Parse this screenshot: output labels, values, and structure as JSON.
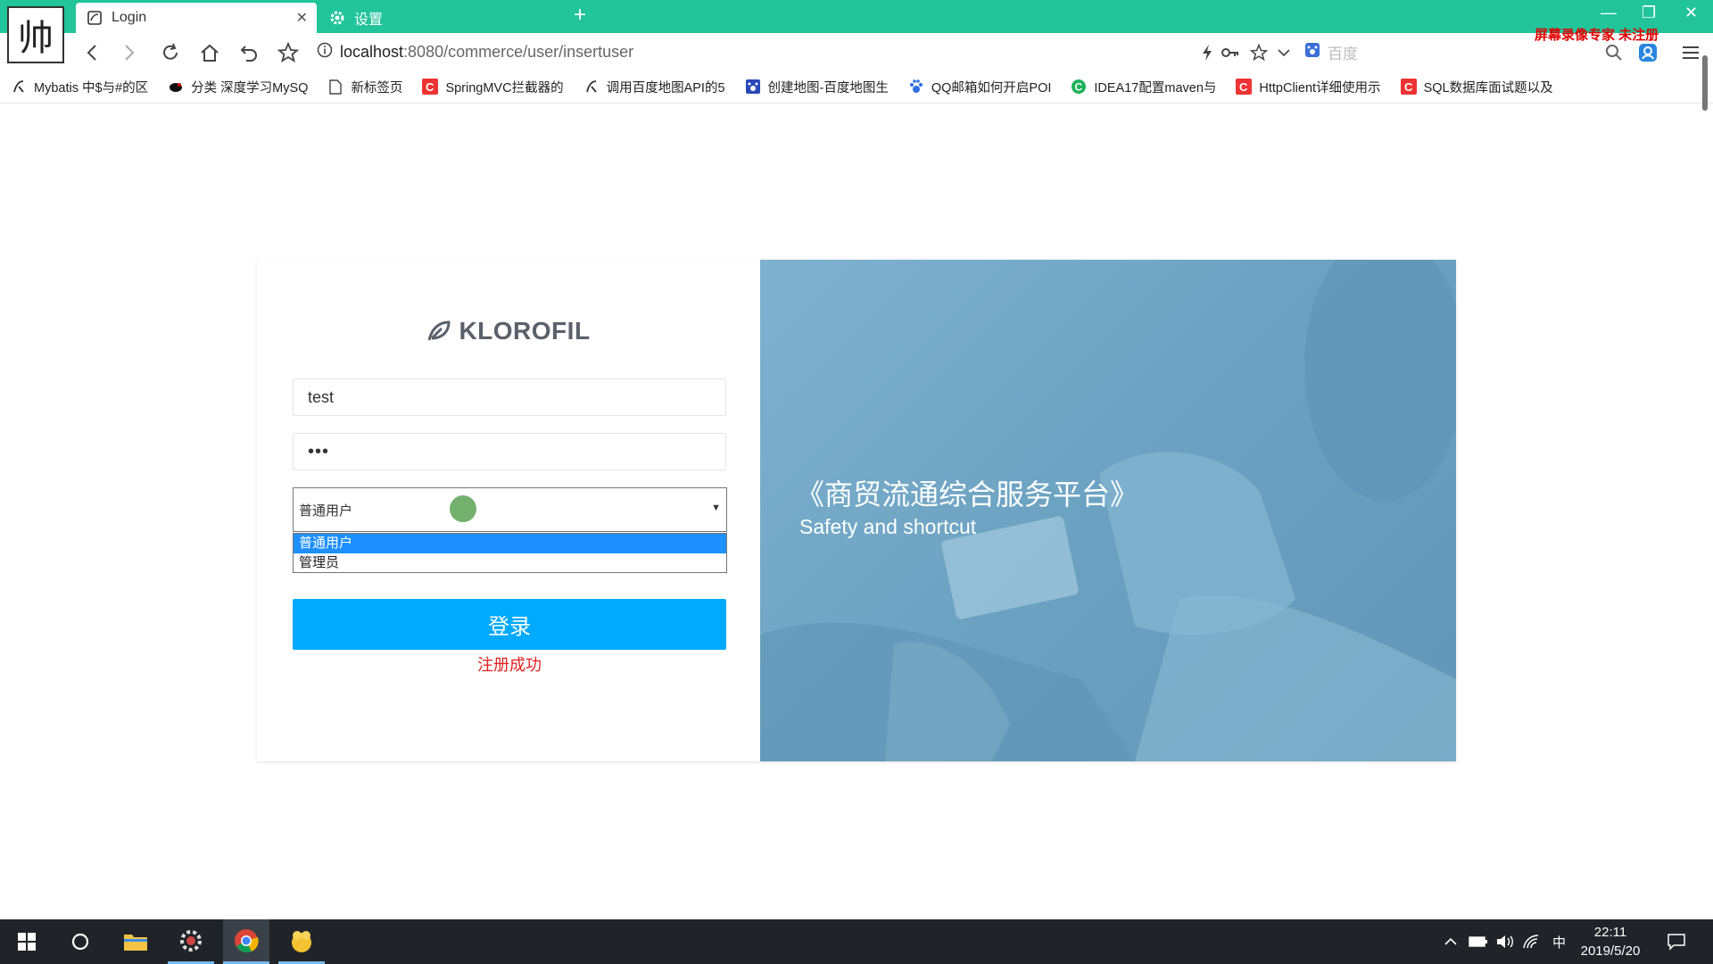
{
  "browser": {
    "tabs": [
      {
        "label": "Login",
        "active": true
      },
      {
        "label": "设置",
        "active": false
      }
    ],
    "address_host": "localhost",
    "address_path": ":8080/commerce/user/insertuser",
    "search_placeholder": "百度",
    "watermark": "屏幕录像专家 未注册",
    "bookmarks": [
      {
        "label": "Mybatis 中$与#的区",
        "icon": "bookmark-icon"
      },
      {
        "label": "分类 深度学习MySQ",
        "icon": "bird-icon"
      },
      {
        "label": "新标签页",
        "icon": "page-icon"
      },
      {
        "label": "SpringMVC拦截器的",
        "icon": "csdn-icon"
      },
      {
        "label": "调用百度地图API的5",
        "icon": "bookmark-icon"
      },
      {
        "label": "创建地图-百度地图生",
        "icon": "baidu-icon"
      },
      {
        "label": "QQ邮箱如何开启POI",
        "icon": "paw-icon"
      },
      {
        "label": "IDEA17配置maven与",
        "icon": "green-c-icon"
      },
      {
        "label": "HttpClient详细使用示",
        "icon": "csdn-icon"
      },
      {
        "label": "SQL数据库面试题以及",
        "icon": "csdn-icon"
      }
    ]
  },
  "login": {
    "brand": "KLOROFIL",
    "username_value": "test",
    "password_value": "•••",
    "role_selected": "普通用户",
    "role_options": [
      "普通用户",
      "管理员"
    ],
    "submit_label": "登录",
    "status_message": "注册成功"
  },
  "banner": {
    "title": "《商贸流通综合服务平台》",
    "subtitle": "Safety and shortcut"
  },
  "taskbar": {
    "time": "22:11",
    "date": "2019/5/20",
    "ime": "中"
  },
  "colors": {
    "titlebar": "#22c49a",
    "primary_button": "#00aaff",
    "status_text": "#e02020",
    "banner_bg": "#6ea4c3"
  }
}
